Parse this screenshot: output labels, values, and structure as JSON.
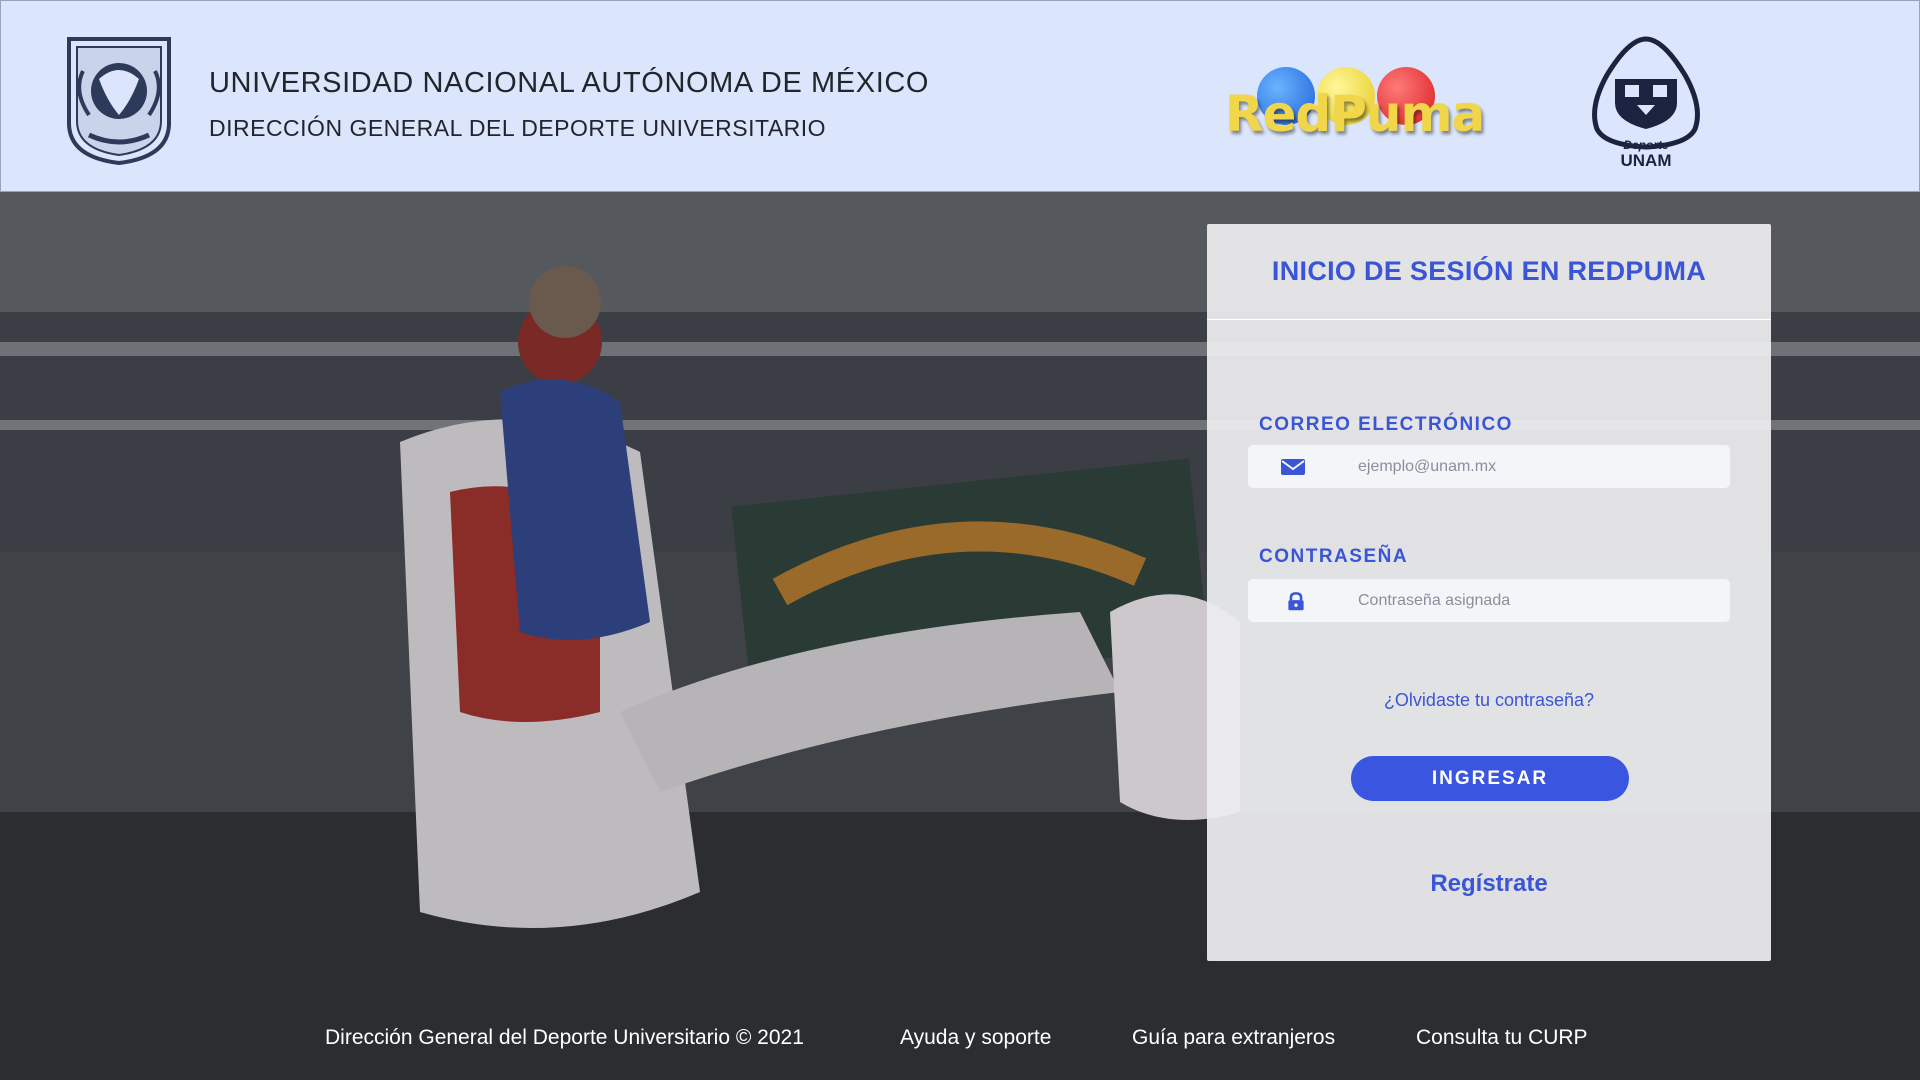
{
  "header": {
    "university": "UNIVERSIDAD NACIONAL AUTÓNOMA DE MÉXICO",
    "department": "DIRECCIÓN GENERAL DEL DEPORTE UNIVERSITARIO",
    "redpuma_logo_text": "RedPuma",
    "deporte_logo_top": "Deporte",
    "deporte_logo_bottom": "UNAM"
  },
  "login": {
    "title": "INICIO DE SESIÓN EN REDPUMA",
    "email_label": "CORREO ELECTRÓNICO",
    "email_placeholder": "ejemplo@unam.mx",
    "email_value": "",
    "password_label": "CONTRASEÑA",
    "password_placeholder": "Contraseña asignada",
    "password_value": "",
    "forgot_link": "¿Olvidaste tu contraseña?",
    "submit_label": "INGRESAR",
    "register_link": "Regístrate"
  },
  "footer": {
    "copyright": "Dirección General del Deporte Universitario © 2021",
    "help": "Ayuda y soporte",
    "foreigners_guide": "Guía para extranjeros",
    "curp": "Consulta tu CURP"
  },
  "colors": {
    "accent": "#3a56d6",
    "button": "#3a56e0",
    "header_bg": "#dbe5fb"
  },
  "icons": {
    "email": "envelope-icon",
    "password": "lock-icon"
  }
}
